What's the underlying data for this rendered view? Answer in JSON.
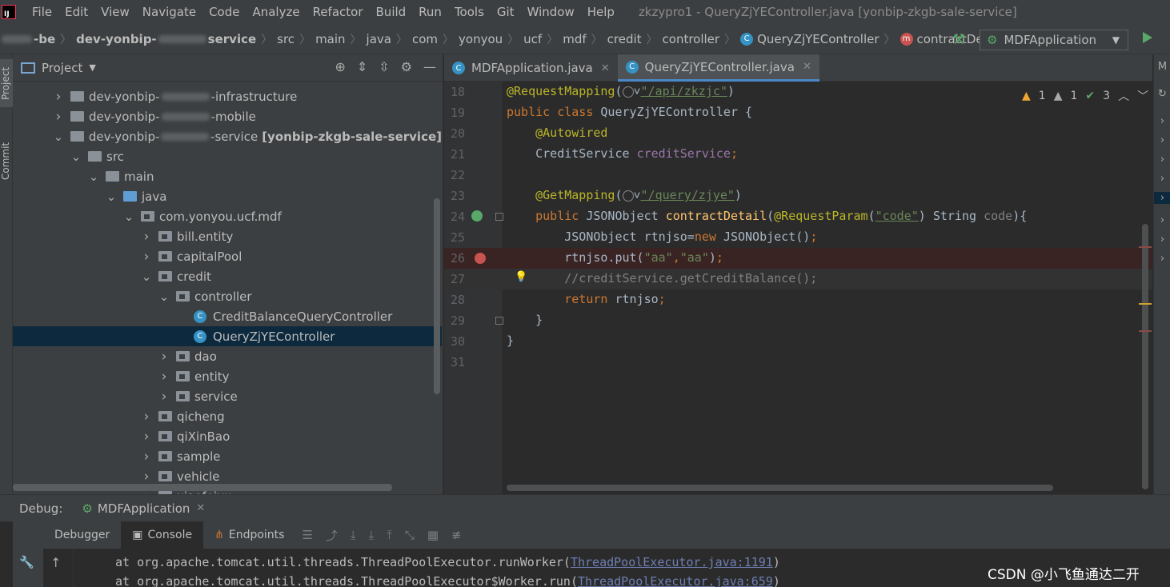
{
  "menubar": {
    "items": [
      "File",
      "Edit",
      "View",
      "Navigate",
      "Code",
      "Analyze",
      "Refactor",
      "Build",
      "Run",
      "Tools",
      "Git",
      "Window",
      "Help"
    ],
    "window_title": "zkzypro1 - QueryZjYEController.java [yonbip-zkgb-sale-service]"
  },
  "breadcrumb": {
    "root_suffix": "-be",
    "module_prefix": "dev-yonbip-",
    "module_suffix": "service",
    "crumbs": [
      "src",
      "main",
      "java",
      "com",
      "yonyou",
      "ucf",
      "mdf",
      "credit",
      "controller"
    ],
    "class_name": "QueryZjYEController",
    "method_name": "contractDetail"
  },
  "run_config": {
    "label": "MDFApplication"
  },
  "left_strip": {
    "project": "Project",
    "commit": "Commit"
  },
  "project_panel": {
    "title": "Project",
    "tree": [
      {
        "label": "dev-yonbip-",
        "suffix": "-infrastructure",
        "extra": "",
        "level": 0,
        "expanded": false,
        "type": "module"
      },
      {
        "label": "dev-yonbip-",
        "suffix": "-mobile",
        "extra": "",
        "level": 0,
        "expanded": false,
        "type": "module"
      },
      {
        "label": "dev-yonbip-",
        "suffix": "-service",
        "extra": "[yonbip-zkgb-sale-service]",
        "level": 0,
        "expanded": true,
        "type": "module"
      },
      {
        "label": "src",
        "suffix": "",
        "extra": "",
        "level": 1,
        "expanded": true,
        "type": "folder"
      },
      {
        "label": "main",
        "suffix": "",
        "extra": "",
        "level": 2,
        "expanded": true,
        "type": "folder"
      },
      {
        "label": "java",
        "suffix": "",
        "extra": "",
        "level": 3,
        "expanded": true,
        "type": "source"
      },
      {
        "label": "com.yonyou.ucf.mdf",
        "suffix": "",
        "extra": "",
        "level": 4,
        "expanded": true,
        "type": "package"
      },
      {
        "label": "bill.entity",
        "suffix": "",
        "extra": "",
        "level": 5,
        "expanded": false,
        "type": "package"
      },
      {
        "label": "capitalPool",
        "suffix": "",
        "extra": "",
        "level": 5,
        "expanded": false,
        "type": "package"
      },
      {
        "label": "credit",
        "suffix": "",
        "extra": "",
        "level": 5,
        "expanded": true,
        "type": "package"
      },
      {
        "label": "controller",
        "suffix": "",
        "extra": "",
        "level": 6,
        "expanded": true,
        "type": "package"
      },
      {
        "label": "CreditBalanceQueryController",
        "suffix": "",
        "extra": "",
        "level": 7,
        "expanded": null,
        "type": "class"
      },
      {
        "label": "QueryZjYEController",
        "suffix": "",
        "extra": "",
        "level": 7,
        "expanded": null,
        "type": "class",
        "selected": true
      },
      {
        "label": "dao",
        "suffix": "",
        "extra": "",
        "level": 6,
        "expanded": false,
        "type": "package"
      },
      {
        "label": "entity",
        "suffix": "",
        "extra": "",
        "level": 6,
        "expanded": false,
        "type": "package"
      },
      {
        "label": "service",
        "suffix": "",
        "extra": "",
        "level": 6,
        "expanded": false,
        "type": "package"
      },
      {
        "label": "qicheng",
        "suffix": "",
        "extra": "",
        "level": 5,
        "expanded": false,
        "type": "package"
      },
      {
        "label": "qiXinBao",
        "suffix": "",
        "extra": "",
        "level": 5,
        "expanded": false,
        "type": "package"
      },
      {
        "label": "sample",
        "suffix": "",
        "extra": "",
        "level": 5,
        "expanded": false,
        "type": "package"
      },
      {
        "label": "vehicle",
        "suffix": "",
        "extra": "",
        "level": 5,
        "expanded": false,
        "type": "package"
      },
      {
        "label": "xiaofeiyu",
        "suffix": "",
        "extra": "",
        "level": 5,
        "expanded": false,
        "type": "package"
      }
    ]
  },
  "editor_tabs": [
    {
      "label": "MDFApplication.java",
      "active": false
    },
    {
      "label": "QueryZjYEController.java",
      "active": true
    }
  ],
  "inspections": {
    "warnings": "1",
    "weak_warnings": "1",
    "ok": "3"
  },
  "code_lines": [
    {
      "n": "18",
      "tokens": [
        [
          "annot",
          "@RequestMapping"
        ],
        [
          "plain",
          "("
        ],
        [
          "globe",
          ""
        ],
        [
          "plain",
          "˅"
        ],
        [
          "strlink",
          "\"/api/zkzjc\""
        ],
        [
          "plain",
          ")"
        ]
      ]
    },
    {
      "n": "19",
      "tokens": [
        [
          "kw",
          "public class "
        ],
        [
          "plain",
          "QueryZjYEController {"
        ]
      ]
    },
    {
      "n": "20",
      "tokens": [
        [
          "plain",
          "    "
        ],
        [
          "annot",
          "@Autowired"
        ]
      ]
    },
    {
      "n": "21",
      "tokens": [
        [
          "plain",
          "    CreditService "
        ],
        [
          "field",
          "creditService"
        ],
        [
          "kw",
          ";"
        ]
      ]
    },
    {
      "n": "22",
      "tokens": []
    },
    {
      "n": "23",
      "tokens": [
        [
          "plain",
          "    "
        ],
        [
          "annot",
          "@GetMapping"
        ],
        [
          "plain",
          "("
        ],
        [
          "globe",
          ""
        ],
        [
          "plain",
          "˅"
        ],
        [
          "strlink",
          "\"/query/zjye\""
        ],
        [
          "plain",
          ")"
        ]
      ]
    },
    {
      "n": "24",
      "tokens": [
        [
          "plain",
          "    "
        ],
        [
          "kw",
          "public "
        ],
        [
          "plain",
          "JSONObject "
        ],
        [
          "fn",
          "contractDetail"
        ],
        [
          "plain",
          "("
        ],
        [
          "annot",
          "@RequestParam"
        ],
        [
          "plain",
          "("
        ],
        [
          "strlink",
          "\"code\""
        ],
        [
          "plain",
          ") String "
        ],
        [
          "cmt",
          "code"
        ],
        [
          "plain",
          "){"
        ]
      ]
    },
    {
      "n": "25",
      "tokens": [
        [
          "plain",
          "        JSONObject rtnjso="
        ],
        [
          "kw",
          "new "
        ],
        [
          "plain",
          "JSONObject()"
        ],
        [
          "kw",
          ";"
        ]
      ]
    },
    {
      "n": "26",
      "tokens": [
        [
          "plain",
          "        rtnjso.put("
        ],
        [
          "str",
          "\"aa\""
        ],
        [
          "kw",
          ","
        ],
        [
          "str",
          "\"aa\""
        ],
        [
          "plain",
          ")"
        ],
        [
          "kw",
          ";"
        ]
      ]
    },
    {
      "n": "27",
      "tokens": [
        [
          "cmt",
          "        //creditService.getCreditBalance();"
        ]
      ]
    },
    {
      "n": "28",
      "tokens": [
        [
          "plain",
          "        "
        ],
        [
          "kw",
          "return "
        ],
        [
          "plain",
          "rtnjso"
        ],
        [
          "kw",
          ";"
        ]
      ]
    },
    {
      "n": "29",
      "tokens": [
        [
          "plain",
          "    }"
        ]
      ]
    },
    {
      "n": "30",
      "tokens": [
        [
          "plain",
          "}"
        ]
      ]
    },
    {
      "n": "31",
      "tokens": []
    }
  ],
  "debug": {
    "label": "Debug:",
    "session": "MDFApplication",
    "tabs": [
      "Debugger",
      "Console",
      "Endpoints"
    ],
    "console_lines": [
      {
        "prefix": "at org.apache.tomcat.util.threads.ThreadPoolExecutor.runWorker(",
        "link": "ThreadPoolExecutor.java:1191",
        "suffix": ")"
      },
      {
        "prefix": "at org.apache.tomcat.util.threads.ThreadPoolExecutor$Worker.run(",
        "link": "ThreadPoolExecutor.java:659",
        "suffix": ")"
      }
    ]
  },
  "right_strip_top": "M",
  "watermark": "CSDN @小飞鱼通达二开",
  "colors": {
    "background": "#2b2b2b",
    "panel": "#3c3f41",
    "selection": "#0d293e",
    "keyword": "#cc7832",
    "annotation": "#bbb529",
    "string": "#6a8759",
    "breakpoint": "#c75450",
    "run_green": "#59a869"
  }
}
